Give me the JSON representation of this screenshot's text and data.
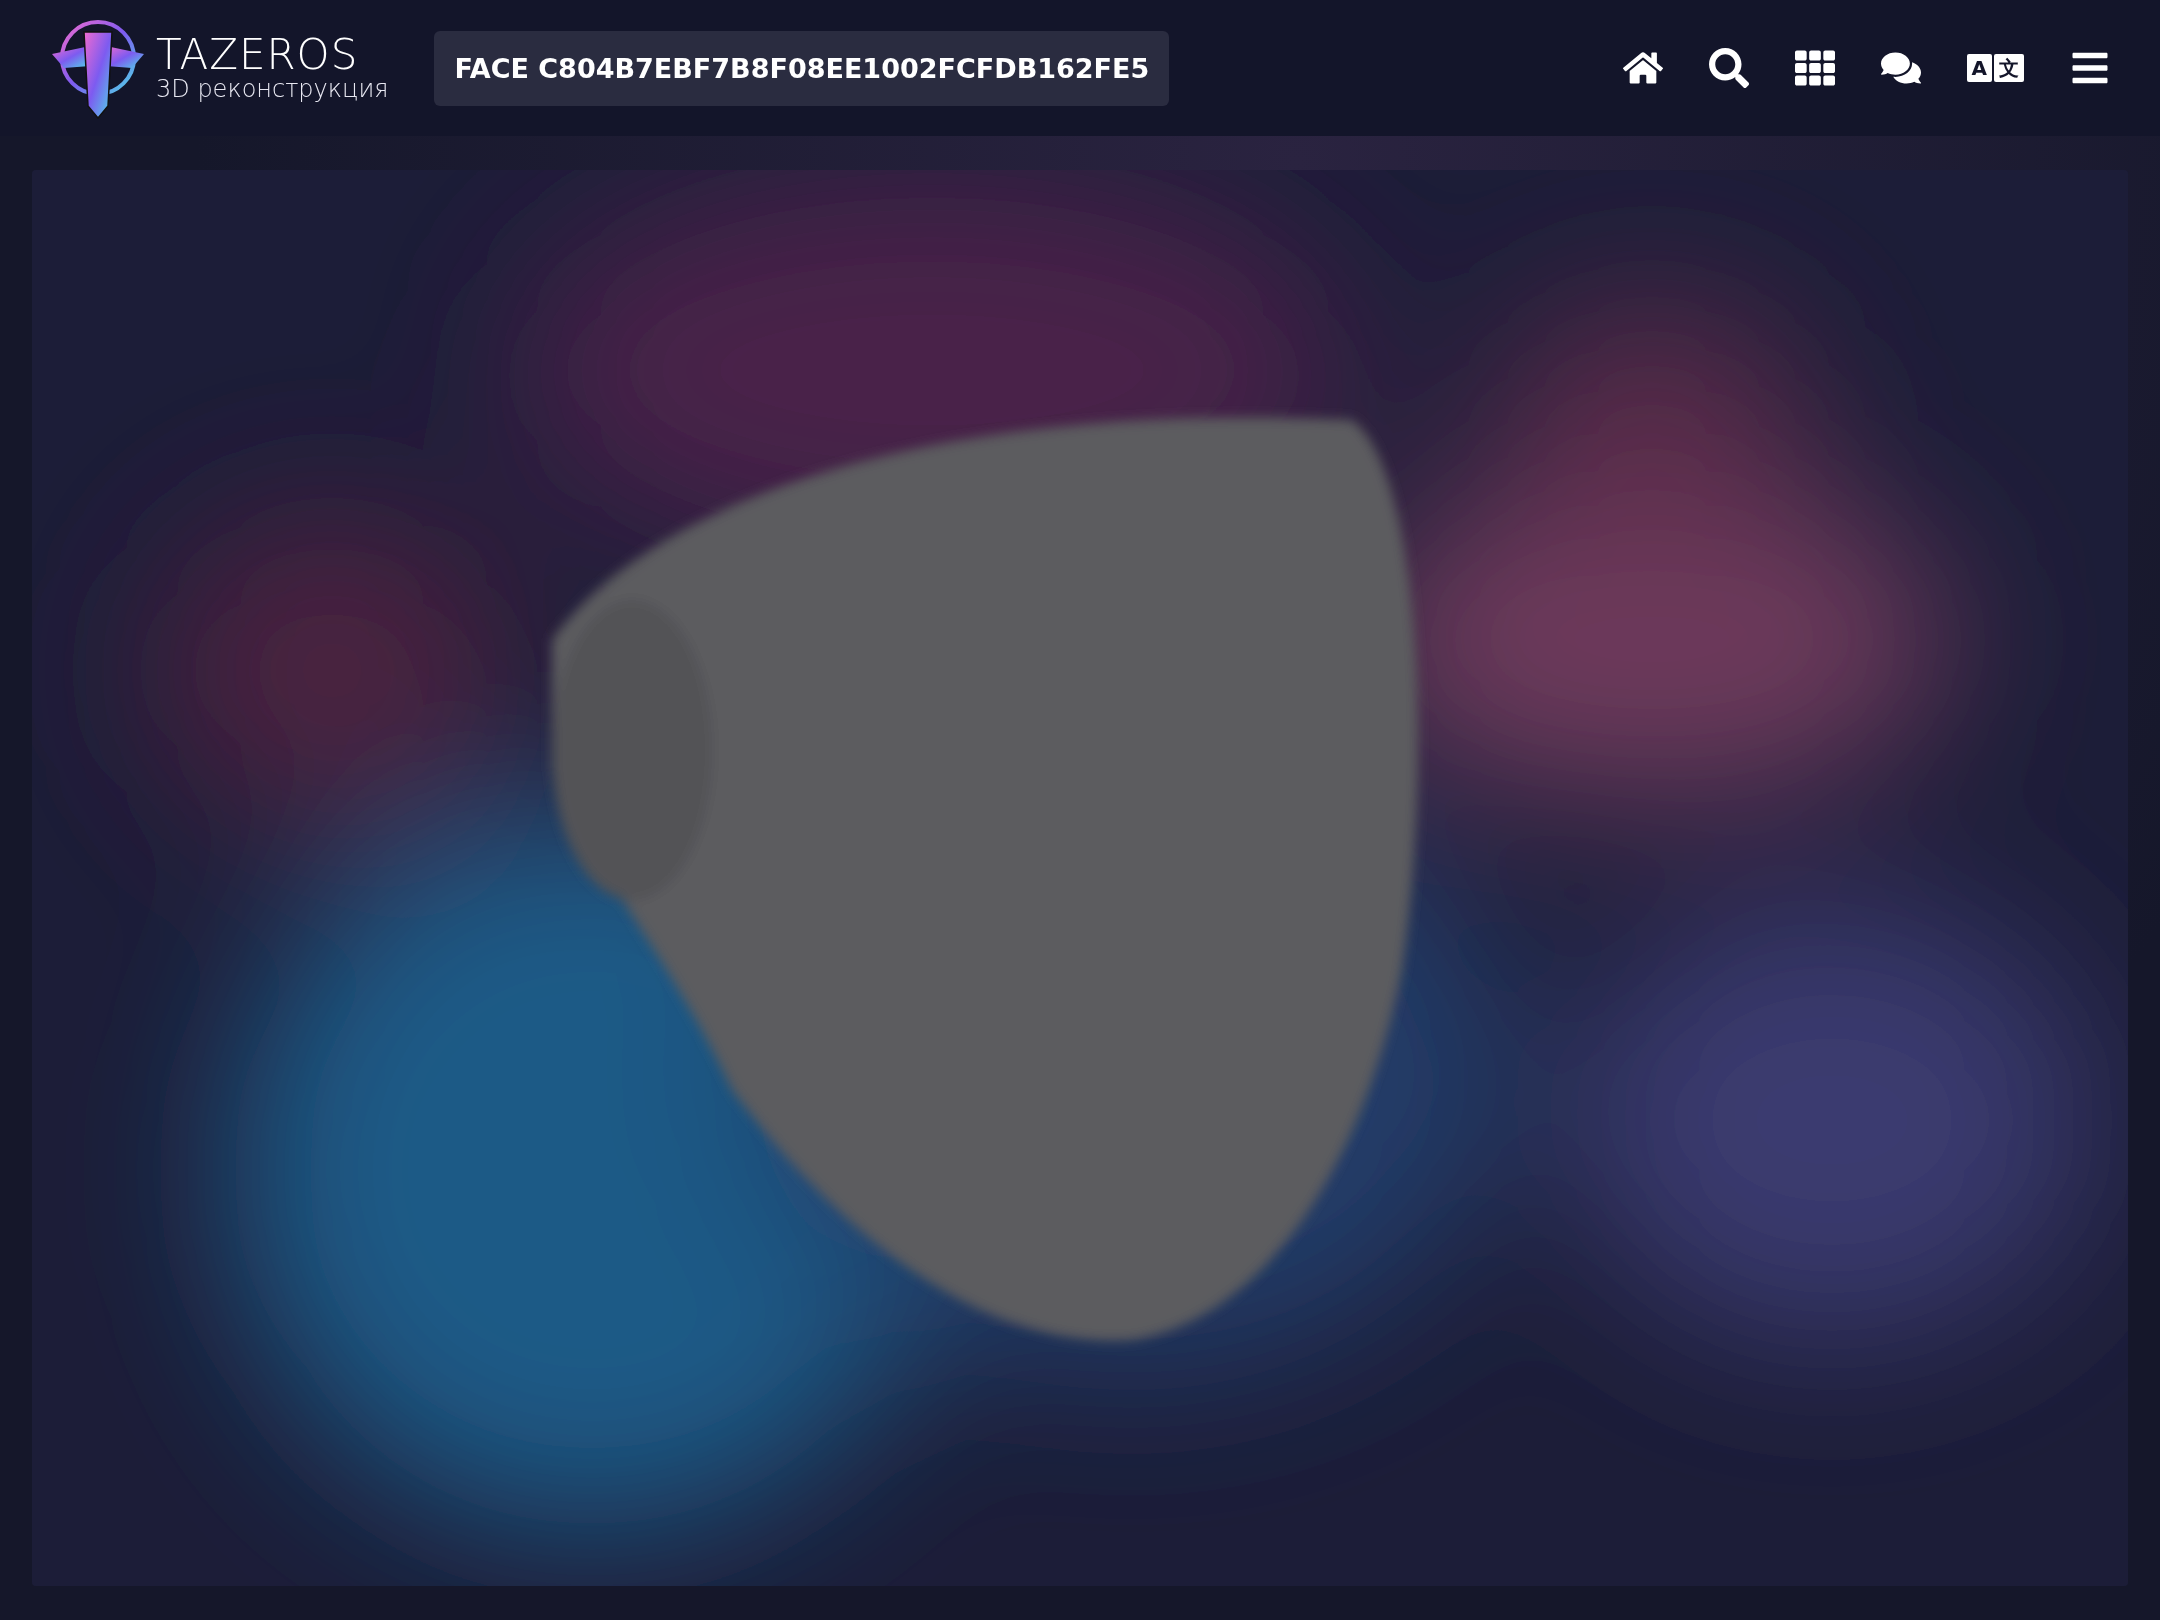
{
  "brand": {
    "name": "TAZEROS",
    "subtitle": "3D реконструкция"
  },
  "model_title": "FACE C804B7EBF7B8F08EE1002FCFDB162FE5",
  "language_button": [
    "A",
    "文"
  ]
}
